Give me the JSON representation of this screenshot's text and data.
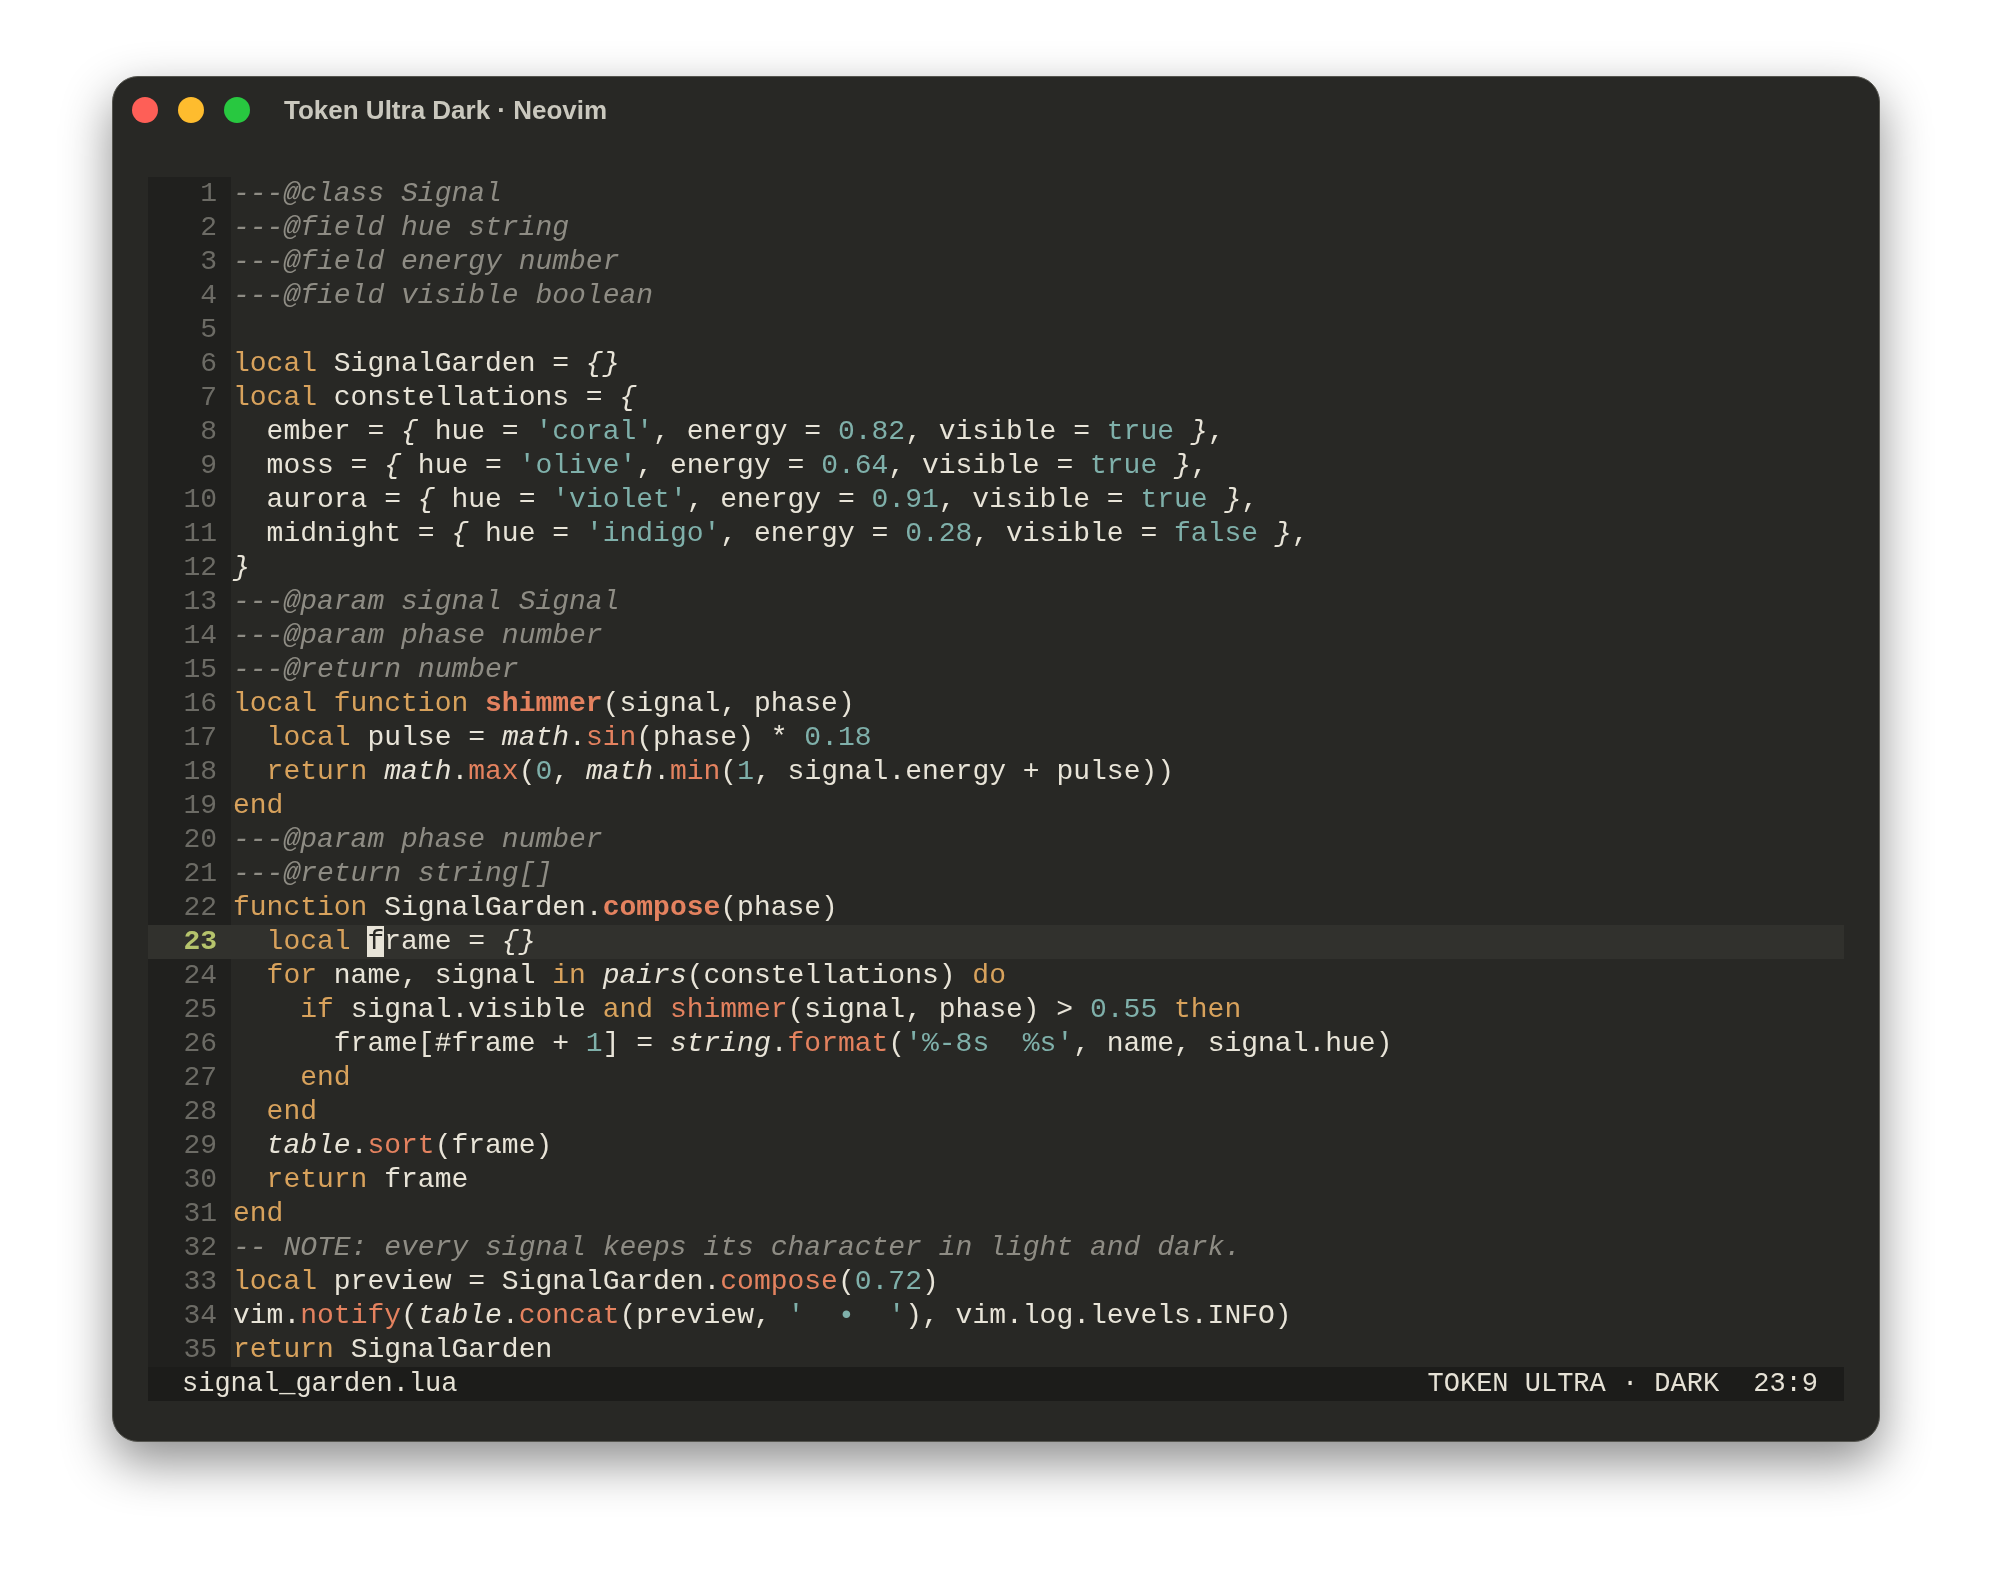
{
  "window": {
    "title": "Token Ultra Dark · Neovim"
  },
  "editor": {
    "lines": [
      {
        "number": "1",
        "current": false,
        "tokens": [
          {
            "text": "---@class Signal",
            "kind": "comment"
          }
        ]
      },
      {
        "number": "2",
        "current": false,
        "tokens": [
          {
            "text": "---@field hue string",
            "kind": "comment"
          }
        ]
      },
      {
        "number": "3",
        "current": false,
        "tokens": [
          {
            "text": "---@field energy number",
            "kind": "comment"
          }
        ]
      },
      {
        "number": "4",
        "current": false,
        "tokens": [
          {
            "text": "---@field visible boolean",
            "kind": "comment"
          }
        ]
      },
      {
        "number": "5",
        "current": false
      },
      {
        "number": "6",
        "current": false,
        "tokens": [
          {
            "text": "local",
            "kind": "keyword"
          },
          {
            "text": " SignalGarden = ",
            "kind": "plain"
          },
          {
            "text": "{}",
            "kind": "italic"
          }
        ]
      },
      {
        "number": "7",
        "current": false,
        "tokens": [
          {
            "text": "local",
            "kind": "keyword"
          },
          {
            "text": " constellations = ",
            "kind": "plain"
          },
          {
            "text": "{",
            "kind": "italic"
          }
        ]
      },
      {
        "number": "8",
        "current": false,
        "tokens": [
          {
            "text": "  ember = ",
            "kind": "plain"
          },
          {
            "text": "{",
            "kind": "italic"
          },
          {
            "text": " hue = ",
            "kind": "plain"
          },
          {
            "text": "'coral'",
            "kind": "string"
          },
          {
            "text": ", energy = ",
            "kind": "plain"
          },
          {
            "text": "0.82",
            "kind": "number"
          },
          {
            "text": ", visible = ",
            "kind": "plain"
          },
          {
            "text": "true",
            "kind": "number"
          },
          {
            "text": " }",
            "kind": "italic"
          },
          {
            "text": ",",
            "kind": "plain"
          }
        ]
      },
      {
        "number": "9",
        "current": false,
        "tokens": [
          {
            "text": "  moss = ",
            "kind": "plain"
          },
          {
            "text": "{",
            "kind": "italic"
          },
          {
            "text": " hue = ",
            "kind": "plain"
          },
          {
            "text": "'olive'",
            "kind": "string"
          },
          {
            "text": ", energy = ",
            "kind": "plain"
          },
          {
            "text": "0.64",
            "kind": "number"
          },
          {
            "text": ", visible = ",
            "kind": "plain"
          },
          {
            "text": "true",
            "kind": "number"
          },
          {
            "text": " }",
            "kind": "italic"
          },
          {
            "text": ",",
            "kind": "plain"
          }
        ]
      },
      {
        "number": "10",
        "current": false,
        "tokens": [
          {
            "text": "  aurora = ",
            "kind": "plain"
          },
          {
            "text": "{",
            "kind": "italic"
          },
          {
            "text": " hue = ",
            "kind": "plain"
          },
          {
            "text": "'violet'",
            "kind": "string"
          },
          {
            "text": ", energy = ",
            "kind": "plain"
          },
          {
            "text": "0.91",
            "kind": "number"
          },
          {
            "text": ", visible = ",
            "kind": "plain"
          },
          {
            "text": "true",
            "kind": "number"
          },
          {
            "text": " }",
            "kind": "italic"
          },
          {
            "text": ",",
            "kind": "plain"
          }
        ]
      },
      {
        "number": "11",
        "current": false,
        "tokens": [
          {
            "text": "  midnight = ",
            "kind": "plain"
          },
          {
            "text": "{",
            "kind": "italic"
          },
          {
            "text": " hue = ",
            "kind": "plain"
          },
          {
            "text": "'indigo'",
            "kind": "string"
          },
          {
            "text": ", energy = ",
            "kind": "plain"
          },
          {
            "text": "0.28",
            "kind": "number"
          },
          {
            "text": ", visible = ",
            "kind": "plain"
          },
          {
            "text": "false",
            "kind": "number"
          },
          {
            "text": " }",
            "kind": "italic"
          },
          {
            "text": ",",
            "kind": "plain"
          }
        ]
      },
      {
        "number": "12",
        "current": false,
        "tokens": [
          {
            "text": "}",
            "kind": "italic"
          }
        ]
      },
      {
        "number": "13",
        "current": false,
        "tokens": [
          {
            "text": "---@param signal Signal",
            "kind": "comment"
          }
        ]
      },
      {
        "number": "14",
        "current": false,
        "tokens": [
          {
            "text": "---@param phase number",
            "kind": "comment"
          }
        ]
      },
      {
        "number": "15",
        "current": false,
        "tokens": [
          {
            "text": "---@return number",
            "kind": "comment"
          }
        ]
      },
      {
        "number": "16",
        "current": false,
        "tokens": [
          {
            "text": "local function",
            "kind": "keyword"
          },
          {
            "text": " shimmer",
            "kind": "definition"
          },
          {
            "text": "(signal, phase)",
            "kind": "plain"
          }
        ]
      },
      {
        "number": "17",
        "current": false,
        "tokens": [
          {
            "text": "  local",
            "kind": "keyword"
          },
          {
            "text": " pulse = ",
            "kind": "plain"
          },
          {
            "text": "math",
            "kind": "italic"
          },
          {
            "text": ".",
            "kind": "plain"
          },
          {
            "text": "sin",
            "kind": "method"
          },
          {
            "text": "(phase) * ",
            "kind": "plain"
          },
          {
            "text": "0.18",
            "kind": "number"
          }
        ]
      },
      {
        "number": "18",
        "current": false,
        "tokens": [
          {
            "text": "  return",
            "kind": "keyword"
          },
          {
            "text": " math",
            "kind": "italic"
          },
          {
            "text": ".",
            "kind": "plain"
          },
          {
            "text": "max",
            "kind": "method"
          },
          {
            "text": "(",
            "kind": "plain"
          },
          {
            "text": "0",
            "kind": "number"
          },
          {
            "text": ", ",
            "kind": "plain"
          },
          {
            "text": "math",
            "kind": "italic"
          },
          {
            "text": ".",
            "kind": "plain"
          },
          {
            "text": "min",
            "kind": "method"
          },
          {
            "text": "(",
            "kind": "plain"
          },
          {
            "text": "1",
            "kind": "number"
          },
          {
            "text": ", signal.energy + pulse))",
            "kind": "plain"
          }
        ]
      },
      {
        "number": "19",
        "current": false,
        "tokens": [
          {
            "text": "end",
            "kind": "keyword"
          }
        ]
      },
      {
        "number": "20",
        "current": false,
        "tokens": [
          {
            "text": "---@param phase number",
            "kind": "comment"
          }
        ]
      },
      {
        "number": "21",
        "current": false,
        "tokens": [
          {
            "text": "---@return string[]",
            "kind": "comment"
          }
        ]
      },
      {
        "number": "22",
        "current": false,
        "tokens": [
          {
            "text": "function",
            "kind": "keyword"
          },
          {
            "text": " SignalGarden.",
            "kind": "plain"
          },
          {
            "text": "compose",
            "kind": "definition"
          },
          {
            "text": "(phase)",
            "kind": "plain"
          }
        ]
      },
      {
        "number": "23",
        "current": true,
        "tokens": [
          {
            "text": "  local ",
            "kind": "keyword"
          },
          {
            "text": "f",
            "kind": "cursor"
          },
          {
            "text": "rame = ",
            "kind": "plain"
          },
          {
            "text": "{}",
            "kind": "italic"
          }
        ]
      },
      {
        "number": "24",
        "current": false,
        "tokens": [
          {
            "text": "  for",
            "kind": "keyword"
          },
          {
            "text": " name, signal ",
            "kind": "plain"
          },
          {
            "text": "in",
            "kind": "keyword"
          },
          {
            "text": " pairs",
            "kind": "italic"
          },
          {
            "text": "(constellations) ",
            "kind": "plain"
          },
          {
            "text": "do",
            "kind": "keyword"
          }
        ]
      },
      {
        "number": "25",
        "current": false,
        "tokens": [
          {
            "text": "    if",
            "kind": "keyword"
          },
          {
            "text": " signal.visible ",
            "kind": "plain"
          },
          {
            "text": "and",
            "kind": "keyword"
          },
          {
            "text": " shimmer",
            "kind": "method"
          },
          {
            "text": "(signal, phase) > ",
            "kind": "plain"
          },
          {
            "text": "0.55",
            "kind": "number"
          },
          {
            "text": " then",
            "kind": "keyword"
          }
        ]
      },
      {
        "number": "26",
        "current": false,
        "tokens": [
          {
            "text": "      frame[#frame + ",
            "kind": "plain"
          },
          {
            "text": "1",
            "kind": "number"
          },
          {
            "text": "] = ",
            "kind": "plain"
          },
          {
            "text": "string",
            "kind": "italic"
          },
          {
            "text": ".",
            "kind": "plain"
          },
          {
            "text": "format",
            "kind": "method"
          },
          {
            "text": "(",
            "kind": "plain"
          },
          {
            "text": "'%-8s  %s'",
            "kind": "string"
          },
          {
            "text": ", name, signal.hue)",
            "kind": "plain"
          }
        ]
      },
      {
        "number": "27",
        "current": false,
        "tokens": [
          {
            "text": "    end",
            "kind": "keyword"
          }
        ]
      },
      {
        "number": "28",
        "current": false,
        "tokens": [
          {
            "text": "  end",
            "kind": "keyword"
          }
        ]
      },
      {
        "number": "29",
        "current": false,
        "tokens": [
          {
            "text": "  table",
            "kind": "italic"
          },
          {
            "text": ".",
            "kind": "plain"
          },
          {
            "text": "sort",
            "kind": "method"
          },
          {
            "text": "(frame)",
            "kind": "plain"
          }
        ]
      },
      {
        "number": "30",
        "current": false,
        "tokens": [
          {
            "text": "  return",
            "kind": "keyword"
          },
          {
            "text": " frame",
            "kind": "plain"
          }
        ]
      },
      {
        "number": "31",
        "current": false,
        "tokens": [
          {
            "text": "end",
            "kind": "keyword"
          }
        ]
      },
      {
        "number": "32",
        "current": false,
        "tokens": [
          {
            "text": "-- NOTE: every signal keeps its character in light and dark.",
            "kind": "comment"
          }
        ]
      },
      {
        "number": "33",
        "current": false,
        "tokens": [
          {
            "text": "local",
            "kind": "keyword"
          },
          {
            "text": " preview = SignalGarden.",
            "kind": "plain"
          },
          {
            "text": "compose",
            "kind": "method"
          },
          {
            "text": "(",
            "kind": "plain"
          },
          {
            "text": "0.72",
            "kind": "number"
          },
          {
            "text": ")",
            "kind": "plain"
          }
        ]
      },
      {
        "number": "34",
        "current": false,
        "tokens": [
          {
            "text": "vim.",
            "kind": "plain"
          },
          {
            "text": "notify",
            "kind": "method"
          },
          {
            "text": "(",
            "kind": "plain"
          },
          {
            "text": "table",
            "kind": "italic"
          },
          {
            "text": ".",
            "kind": "plain"
          },
          {
            "text": "concat",
            "kind": "method"
          },
          {
            "text": "(preview, ",
            "kind": "plain"
          },
          {
            "text": "'  •  '",
            "kind": "string"
          },
          {
            "text": "), vim.log.levels.INFO)",
            "kind": "plain"
          }
        ]
      },
      {
        "number": "35",
        "current": false,
        "tokens": [
          {
            "text": "return",
            "kind": "keyword"
          },
          {
            "text": " SignalGarden",
            "kind": "plain"
          }
        ]
      }
    ]
  },
  "status_bar": {
    "filename": "signal_garden.lua",
    "theme": "TOKEN ULTRA · DARK",
    "position": "23:9"
  }
}
